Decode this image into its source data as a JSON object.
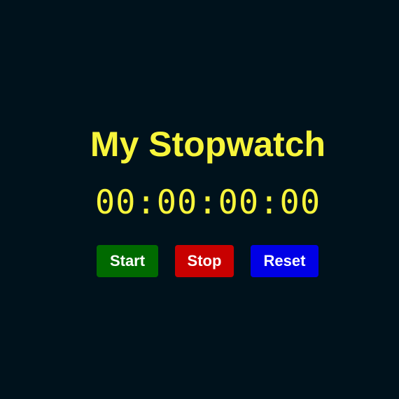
{
  "app": {
    "title": "My Stopwatch",
    "time_display": "00:00:00:00"
  },
  "controls": {
    "start_label": "Start",
    "stop_label": "Stop",
    "reset_label": "Reset"
  },
  "colors": {
    "background": "#00121c",
    "title_and_time": "#f7f53b",
    "start_button": "#006a00",
    "stop_button": "#c80000",
    "reset_button": "#0000e6",
    "button_text": "#ffffff"
  }
}
